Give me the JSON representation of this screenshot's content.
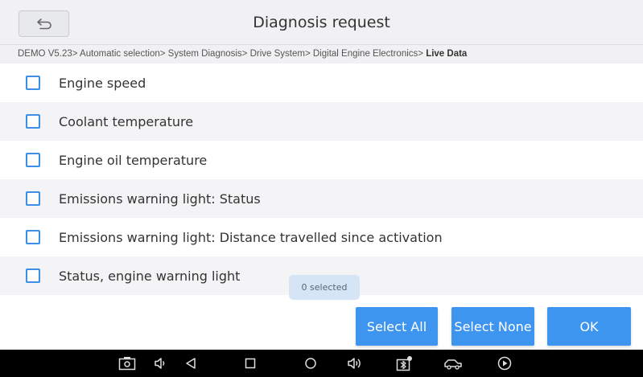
{
  "header": {
    "title": "Diagnosis request",
    "back_icon": "back-arrow-icon"
  },
  "breadcrumb": {
    "path": "DEMO V5.23> Automatic selection> System Diagnosis> Drive System> Digital Engine Electronics> ",
    "current": "Live Data"
  },
  "items": [
    {
      "label": "Engine speed",
      "checked": false
    },
    {
      "label": "Coolant temperature",
      "checked": false
    },
    {
      "label": "Engine oil temperature",
      "checked": false
    },
    {
      "label": "Emissions warning light: Status",
      "checked": false
    },
    {
      "label": "Emissions warning light: Distance travelled since activation",
      "checked": false
    },
    {
      "label": "Status, engine warning light",
      "checked": false
    }
  ],
  "selection_toast": "0 selected",
  "buttons": {
    "select_all": "Select All",
    "select_none": "Select None",
    "ok": "OK"
  },
  "navbar": {
    "icons": [
      "screenshot-icon",
      "volume-down-icon",
      "back-triangle-icon",
      "recent-apps-square-icon",
      "home-circle-icon",
      "volume-up-icon",
      "bluetooth-icon",
      "vehicle-icon",
      "play-icon"
    ]
  },
  "colors": {
    "accent": "#3d95ef",
    "header_bg": "#f1f1f3",
    "navbar_bg": "#000000"
  }
}
